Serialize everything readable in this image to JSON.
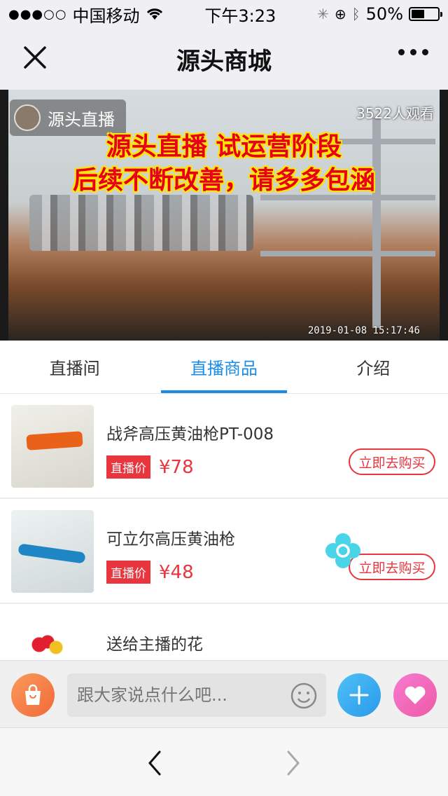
{
  "status": {
    "carrier": "中国移动",
    "time": "下午3:23",
    "battery": "50%",
    "battery_level": 0.5
  },
  "nav": {
    "title": "源头商城"
  },
  "video": {
    "host_name": "源头直播",
    "viewers": "3522人观看",
    "banner_line1": "源头直播 试运营阶段",
    "banner_line2": "后续不断改善，请多多包涵",
    "timestamp": "2019-01-08 15:17:46"
  },
  "tabs": [
    {
      "label": "直播间",
      "active": false
    },
    {
      "label": "直播商品",
      "active": true
    },
    {
      "label": "介绍",
      "active": false
    }
  ],
  "products": [
    {
      "name": "战斧高压黄油枪PT-008",
      "tag": "直播价",
      "price": "¥78",
      "buy_label": "立即去购买"
    },
    {
      "name": "可立尔高压黄油枪",
      "tag": "直播价",
      "price": "¥48",
      "buy_label": "立即去购买"
    },
    {
      "name": "送给主播的花",
      "tag": "",
      "price": "",
      "buy_label": ""
    }
  ],
  "chat": {
    "placeholder": "跟大家说点什么吧..."
  },
  "colors": {
    "accent_blue": "#1a8ce6",
    "price_red": "#e8353e"
  }
}
